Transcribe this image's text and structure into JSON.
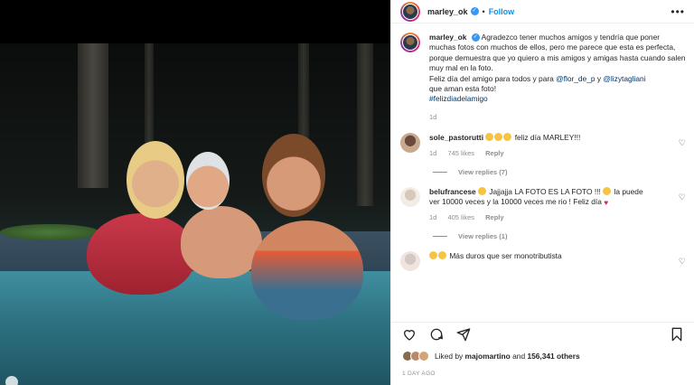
{
  "post": {
    "username": "marley_ok",
    "follow_label": "Follow",
    "more_label": "•••"
  },
  "caption": {
    "username": "marley_ok",
    "text": "Agradezco tener muchos amigos y tendría que poner muchas fotos con muchos de ellos, pero me parece que esta es perfecta, porque demuestra que yo quiero a mis amigos y amigas hasta cuando salen muy mal en la foto.",
    "text2": "Feliz día del amigo para todos y para ",
    "mention1": "@flor_de_p",
    "and": " y ",
    "mention2": "@lizytagliani",
    "text3": " que aman esta foto!",
    "hashtag": "#felizdiadelamigo",
    "time": "1d"
  },
  "comments": [
    {
      "username": "sole_pastorutti",
      "text": "feliz día MARLEY!!!",
      "time": "1d",
      "likes": "745 likes",
      "reply": "Reply",
      "view_replies": "View replies (7)"
    },
    {
      "username": "belufrancese",
      "text_a": "Jajjajja LA FOTO ES LA FOTO !!! ",
      "text_b": " la puede ver 10000 veces y la 10000 veces me rio ! Feliz día ",
      "time": "1d",
      "likes": "405 likes",
      "reply": "Reply",
      "view_replies": "View replies (1)"
    },
    {
      "username": "",
      "text": "Más duros que ser monotributista"
    }
  ],
  "footer": {
    "liked_by_prefix": "Liked by ",
    "liked_by_user": "majomartino",
    "liked_by_suffix": " and ",
    "others": "156,341 others",
    "time_ago": "1 DAY AGO"
  },
  "icons": [
    "heart-icon",
    "comment-icon",
    "share-icon",
    "bookmark-icon",
    "verified-icon",
    "more-icon"
  ],
  "colors": {
    "accent": "#0095f6",
    "link": "#00376b",
    "heart": "#e0245e"
  }
}
